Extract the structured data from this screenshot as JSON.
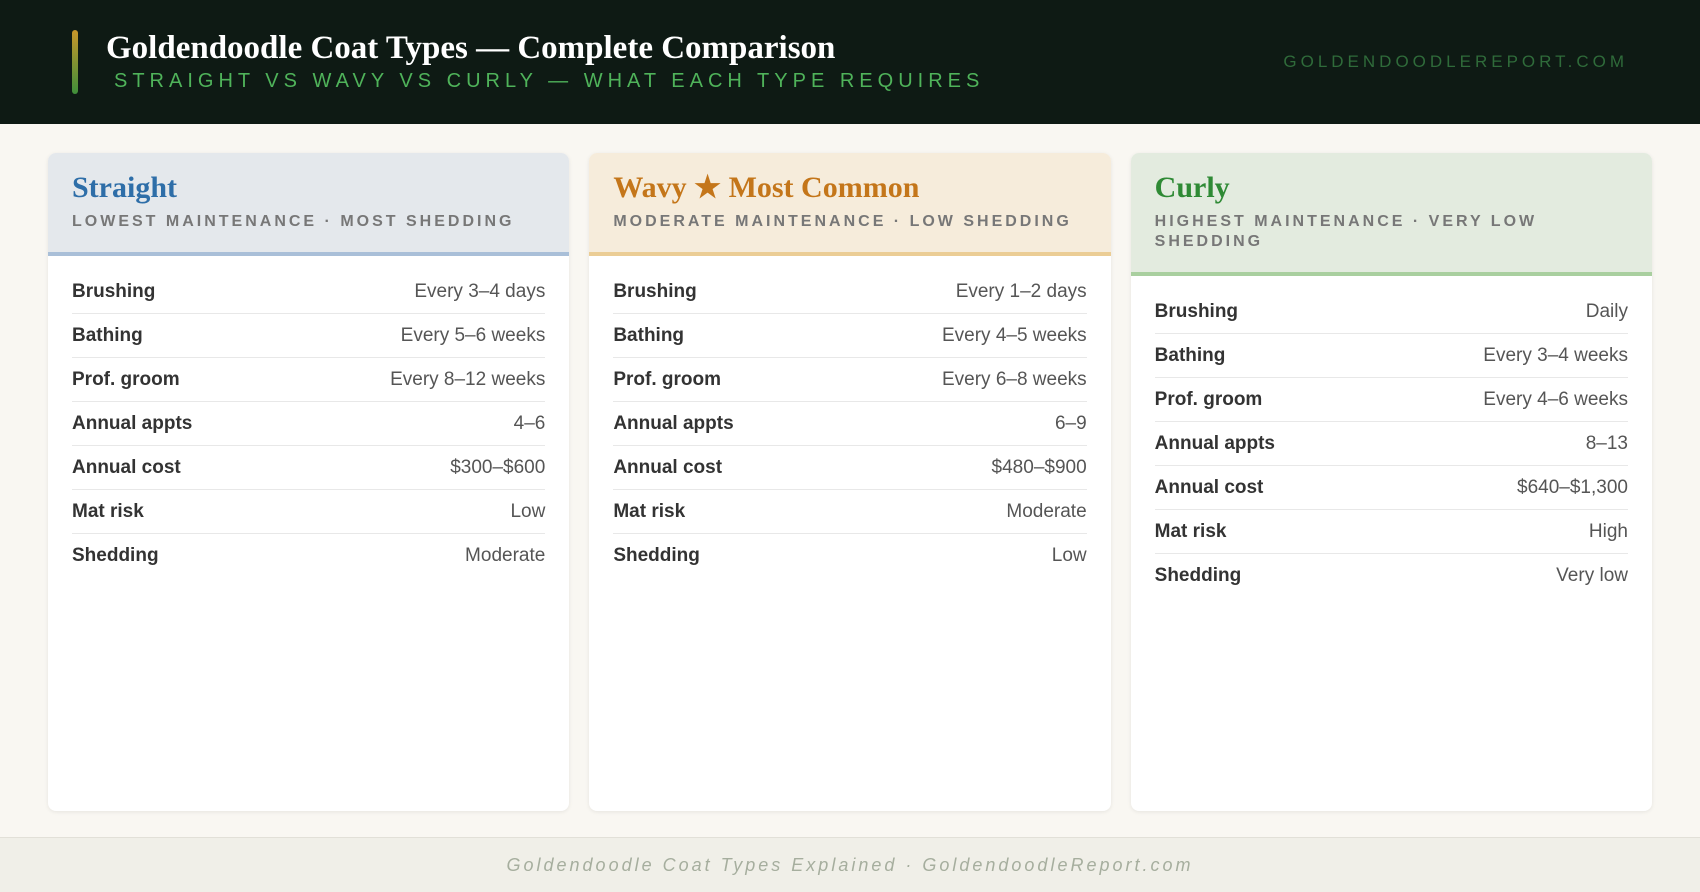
{
  "header": {
    "title": "Goldendoodle Coat Types — Complete Comparison",
    "subtitle": "STRAIGHT VS WAVY VS CURLY — WHAT EACH TYPE REQUIRES",
    "site": "GOLDENDOODLEREPORT.COM"
  },
  "colors": {
    "header_bg": "#0e1a14",
    "straight_accent": "#2e6ea8",
    "wavy_accent": "#c4761a",
    "curly_accent": "#2f8a35",
    "subtitle_green": "#4fb35a"
  },
  "cards": [
    {
      "title": "Straight",
      "subtitle": "Lowest maintenance · Most shedding",
      "rows": [
        {
          "label": "Brushing",
          "value": "Every 3–4 days"
        },
        {
          "label": "Bathing",
          "value": "Every 5–6 weeks"
        },
        {
          "label": "Prof. groom",
          "value": "Every 8–12 weeks"
        },
        {
          "label": "Annual appts",
          "value": "4–6"
        },
        {
          "label": "Annual cost",
          "value": "$300–$600"
        },
        {
          "label": "Mat risk",
          "value": "Low"
        },
        {
          "label": "Shedding",
          "value": "Moderate"
        }
      ]
    },
    {
      "title": "Wavy ★ Most Common",
      "subtitle": "Moderate maintenance · Low shedding",
      "rows": [
        {
          "label": "Brushing",
          "value": "Every 1–2 days"
        },
        {
          "label": "Bathing",
          "value": "Every 4–5 weeks"
        },
        {
          "label": "Prof. groom",
          "value": "Every 6–8 weeks"
        },
        {
          "label": "Annual appts",
          "value": "6–9"
        },
        {
          "label": "Annual cost",
          "value": "$480–$900"
        },
        {
          "label": "Mat risk",
          "value": "Moderate"
        },
        {
          "label": "Shedding",
          "value": "Low"
        }
      ]
    },
    {
      "title": "Curly",
      "subtitle": "Highest maintenance · Very low shedding",
      "rows": [
        {
          "label": "Brushing",
          "value": "Daily"
        },
        {
          "label": "Bathing",
          "value": "Every 3–4 weeks"
        },
        {
          "label": "Prof. groom",
          "value": "Every 4–6 weeks"
        },
        {
          "label": "Annual appts",
          "value": "8–13"
        },
        {
          "label": "Annual cost",
          "value": "$640–$1,300"
        },
        {
          "label": "Mat risk",
          "value": "High"
        },
        {
          "label": "Shedding",
          "value": "Very low"
        }
      ]
    }
  ],
  "footer": {
    "text": "Goldendoodle Coat Types Explained · GoldendoodleReport.com"
  }
}
